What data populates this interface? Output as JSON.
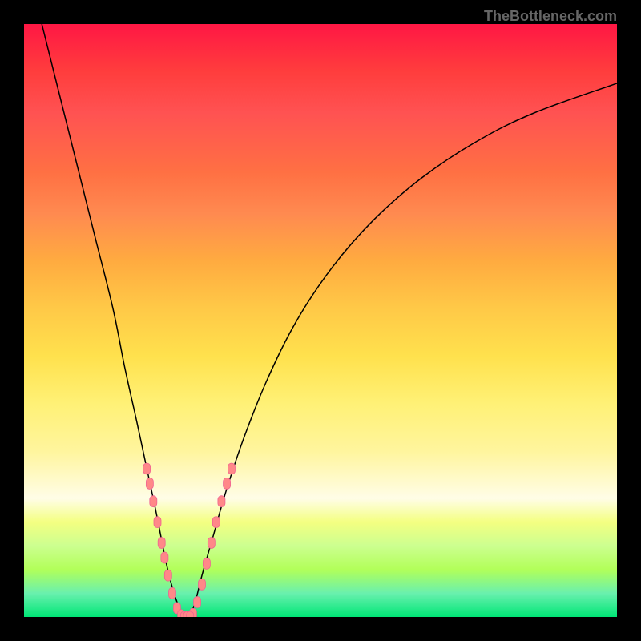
{
  "watermark": "TheBottleneck.com",
  "chart_data": {
    "type": "line",
    "title": "",
    "xlabel": "",
    "ylabel": "",
    "xlim": [
      0,
      100
    ],
    "ylim": [
      0,
      100
    ],
    "left_curve": [
      {
        "x": 3,
        "y": 100
      },
      {
        "x": 6,
        "y": 88
      },
      {
        "x": 9,
        "y": 76
      },
      {
        "x": 12,
        "y": 64
      },
      {
        "x": 15,
        "y": 52
      },
      {
        "x": 17,
        "y": 42
      },
      {
        "x": 19,
        "y": 33
      },
      {
        "x": 20.5,
        "y": 26
      },
      {
        "x": 22,
        "y": 19
      },
      {
        "x": 23,
        "y": 14
      },
      {
        "x": 24,
        "y": 9
      },
      {
        "x": 25,
        "y": 5
      },
      {
        "x": 26,
        "y": 2
      },
      {
        "x": 27,
        "y": 0
      }
    ],
    "right_curve": [
      {
        "x": 28,
        "y": 0
      },
      {
        "x": 29,
        "y": 3
      },
      {
        "x": 30,
        "y": 7
      },
      {
        "x": 32,
        "y": 14
      },
      {
        "x": 34,
        "y": 21
      },
      {
        "x": 37,
        "y": 30
      },
      {
        "x": 41,
        "y": 40
      },
      {
        "x": 46,
        "y": 50
      },
      {
        "x": 52,
        "y": 59
      },
      {
        "x": 59,
        "y": 67
      },
      {
        "x": 67,
        "y": 74
      },
      {
        "x": 76,
        "y": 80
      },
      {
        "x": 86,
        "y": 85
      },
      {
        "x": 100,
        "y": 90
      }
    ],
    "markers_left": [
      {
        "x": 20.7,
        "y": 25
      },
      {
        "x": 21.2,
        "y": 22.5
      },
      {
        "x": 21.8,
        "y": 19.5
      },
      {
        "x": 22.5,
        "y": 16
      },
      {
        "x": 23.2,
        "y": 12.5
      },
      {
        "x": 23.7,
        "y": 10
      },
      {
        "x": 24.3,
        "y": 7
      },
      {
        "x": 25,
        "y": 4
      },
      {
        "x": 25.8,
        "y": 1.5
      },
      {
        "x": 26.5,
        "y": 0.3
      }
    ],
    "markers_right": [
      {
        "x": 28.5,
        "y": 0.5
      },
      {
        "x": 29.2,
        "y": 2.5
      },
      {
        "x": 30,
        "y": 5.5
      },
      {
        "x": 30.8,
        "y": 9
      },
      {
        "x": 31.6,
        "y": 12.5
      },
      {
        "x": 32.4,
        "y": 16
      },
      {
        "x": 33.3,
        "y": 19.5
      },
      {
        "x": 34.2,
        "y": 22.5
      },
      {
        "x": 35,
        "y": 25
      }
    ],
    "markers_bottom": [
      {
        "x": 27,
        "y": 0
      },
      {
        "x": 27.5,
        "y": 0
      },
      {
        "x": 28,
        "y": 0
      }
    ]
  }
}
